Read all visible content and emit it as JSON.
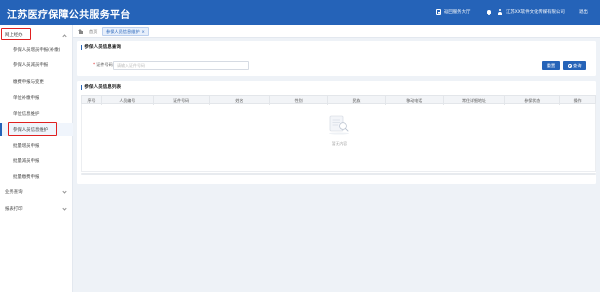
{
  "header": {
    "app_title": "江苏医疗保障公共服务平台",
    "return_link": "返回服务大厅",
    "org_name": "江苏XX软件文化传媒有限公司",
    "logout": "退出"
  },
  "sidebar": {
    "groups": [
      {
        "label": "网上经办",
        "expanded": true
      },
      {
        "label": "业务查询",
        "expanded": false
      },
      {
        "label": "报表打印",
        "expanded": false
      }
    ],
    "items": [
      {
        "label": "参保人员增员申报(补缴)"
      },
      {
        "label": "参保人员减员申报"
      },
      {
        "label": "缴费申报与变更"
      },
      {
        "label": "单位补缴申报"
      },
      {
        "label": "单位信息维护"
      },
      {
        "label": "参保人员信息维护"
      },
      {
        "label": "批量增员申报"
      },
      {
        "label": "批量减员申报"
      },
      {
        "label": "批量缴费申报"
      }
    ],
    "active_item": "参保人员信息维护"
  },
  "tabs": {
    "home": "首页",
    "active": "参保人员信息维护",
    "close": "×"
  },
  "query_panel": {
    "title": "参保人员信息查询",
    "id_label": "证件号码",
    "id_placeholder": "请输入证件号码",
    "reset_label": "重置",
    "search_label": "查询"
  },
  "list_panel": {
    "title": "参保人员信息列表",
    "columns": [
      "序号",
      "人员编号",
      "证件号码",
      "姓名",
      "性别",
      "民族",
      "移动电话",
      "常住详细地址",
      "参保状态",
      "操作"
    ],
    "rows": [],
    "empty_text": "暂无内容"
  },
  "colors": {
    "primary": "#2563b8",
    "highlight_box": "#e02020",
    "background": "#eef2f7"
  }
}
